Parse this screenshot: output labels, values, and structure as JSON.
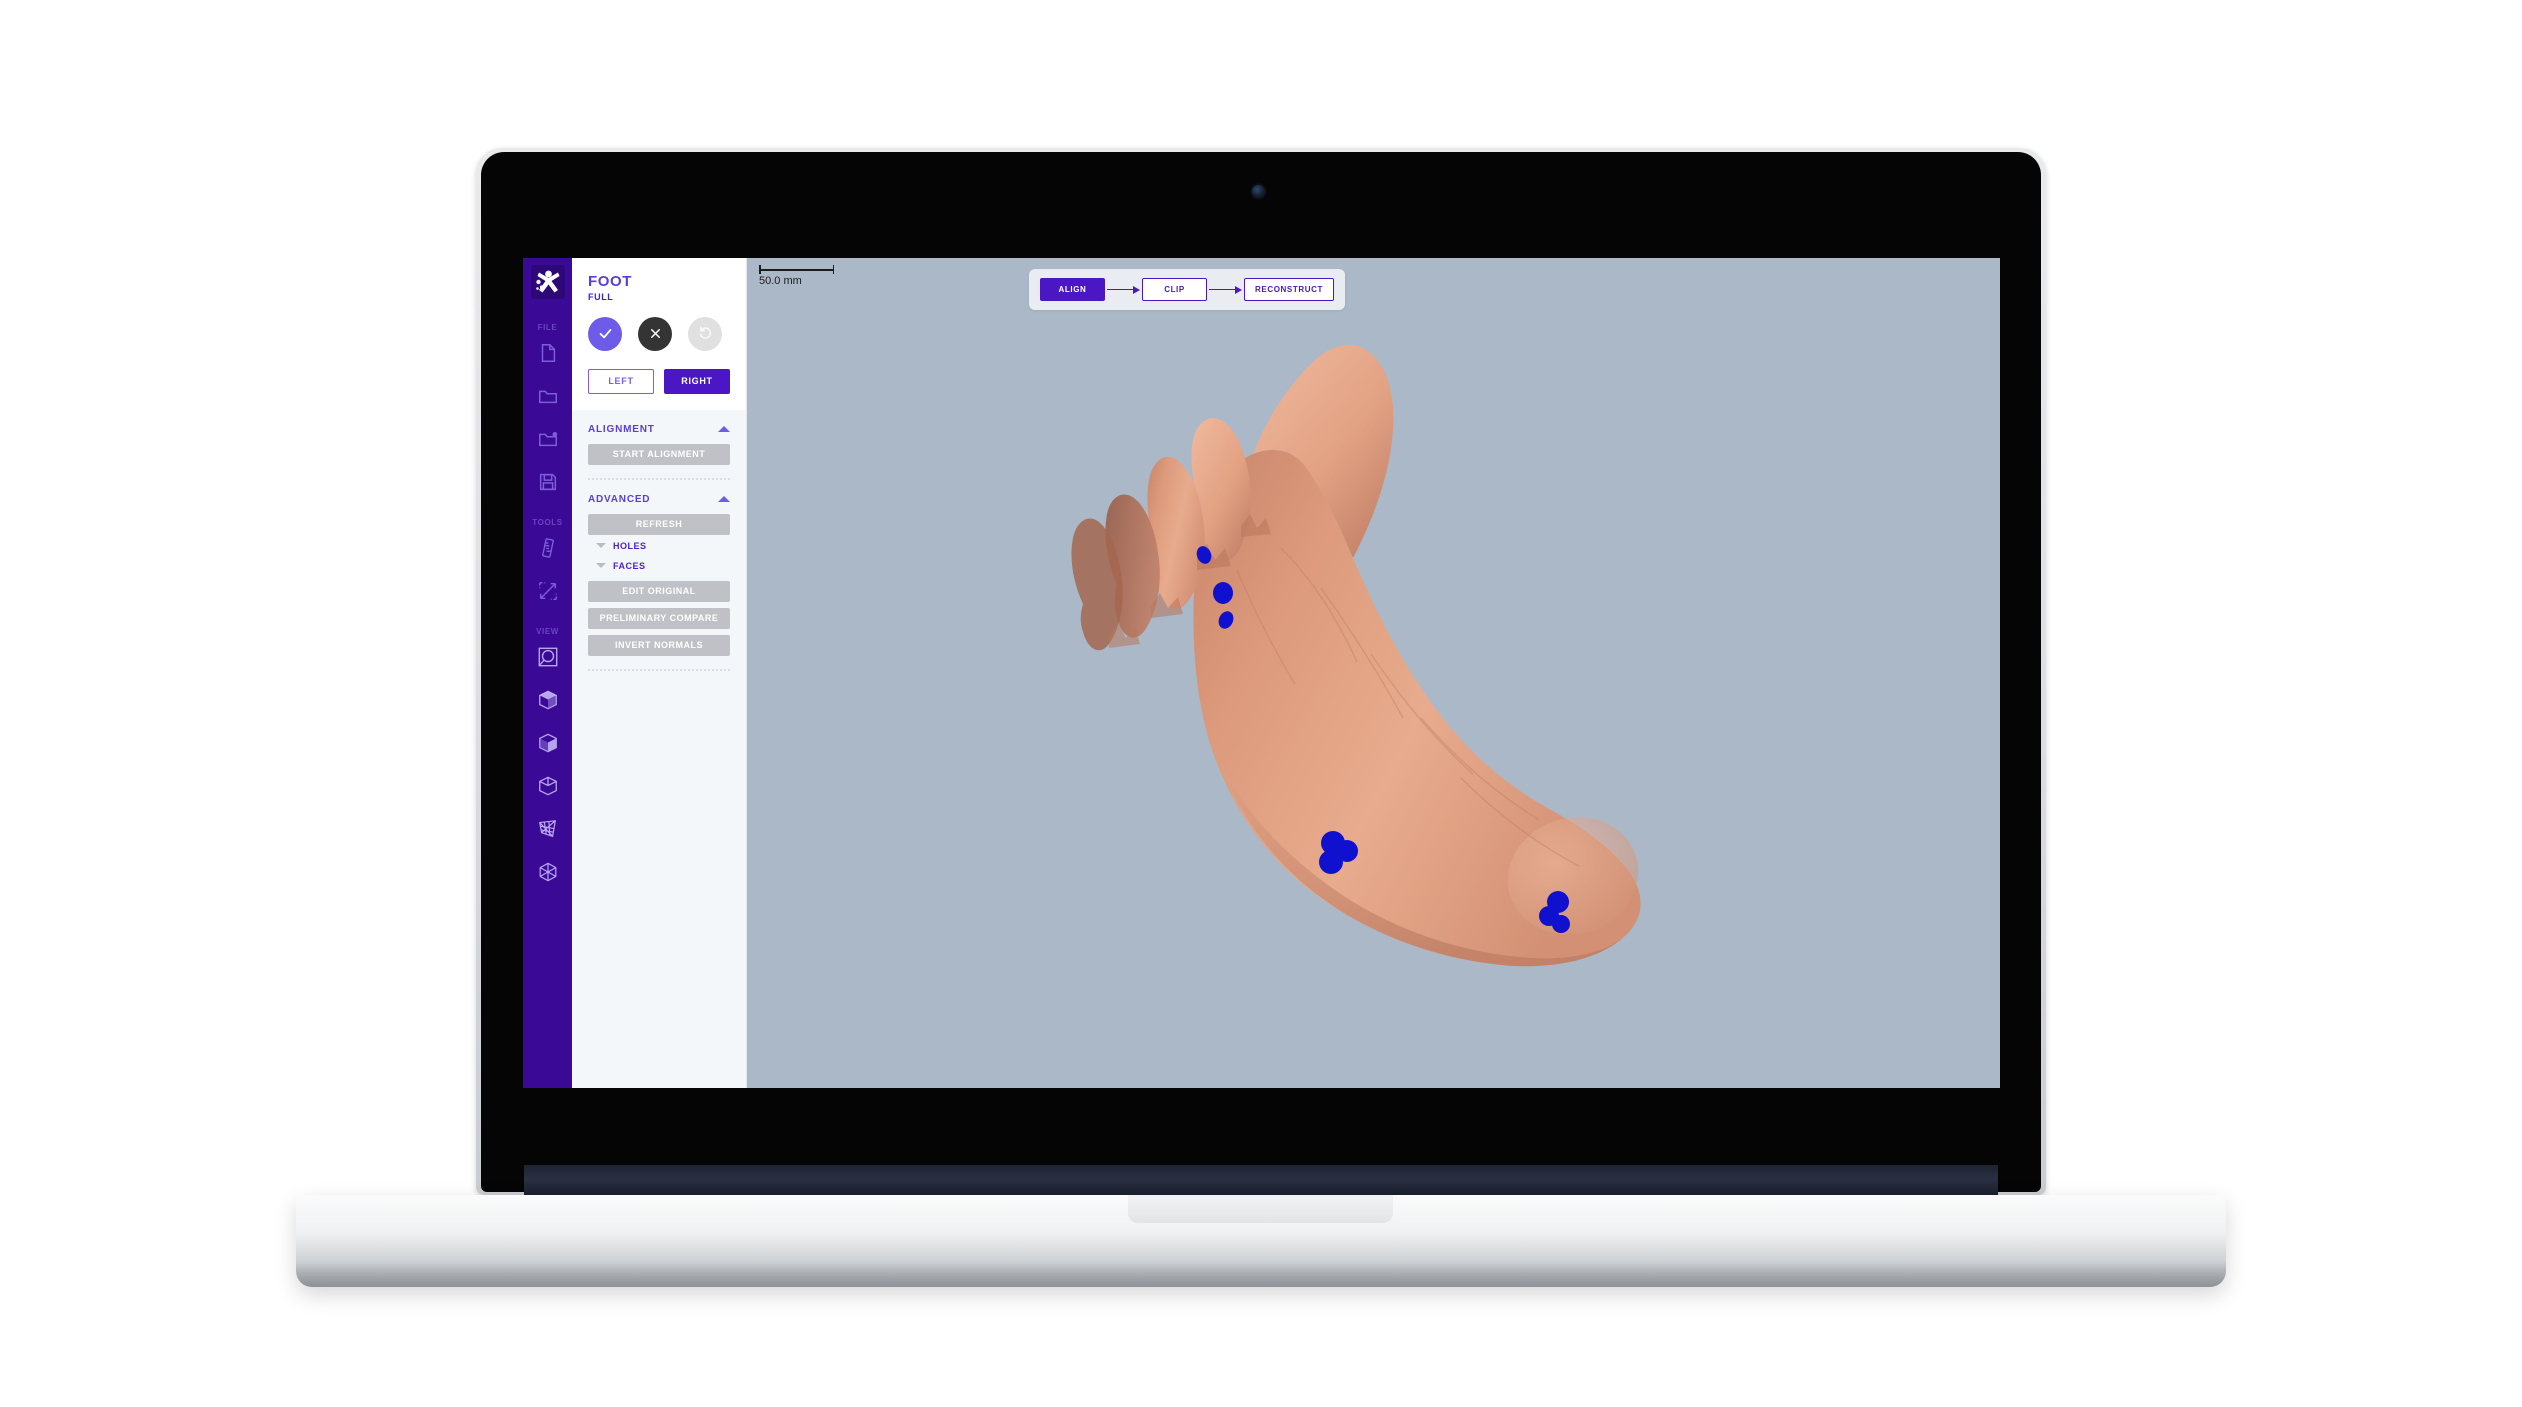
{
  "app": {
    "logo_icon": "human-figure-logo",
    "screen_bg": "#f4f7fa",
    "accent_purple": "#4b17c4",
    "accent_light_purple": "#6c5ce7",
    "rail_bg": "#3a0a96",
    "viewport_bg": "#aab8c8",
    "model_color": "#dd9a7c",
    "marker_color": "#1010cf"
  },
  "rail": {
    "groups": [
      {
        "label": "FILE",
        "items": [
          {
            "name": "new-file-icon",
            "title": "New"
          },
          {
            "name": "open-folder-icon",
            "title": "Open"
          },
          {
            "name": "open-folder-add-icon",
            "title": "Import"
          },
          {
            "name": "save-disk-icon",
            "title": "Save"
          }
        ]
      },
      {
        "label": "TOOLS",
        "items": [
          {
            "name": "ruler-icon",
            "title": "Measure"
          },
          {
            "name": "resize-icon",
            "title": "Scale"
          }
        ]
      },
      {
        "label": "VIEW",
        "items": [
          {
            "name": "viewport-circle-icon",
            "title": "Fit View"
          },
          {
            "name": "cube-shaded-icon",
            "title": "Shaded"
          },
          {
            "name": "cube-solid-icon",
            "title": "Solid"
          },
          {
            "name": "cube-outline-icon",
            "title": "Wireframe Box"
          },
          {
            "name": "mesh-grid-icon",
            "title": "Mesh"
          },
          {
            "name": "polygon-icon",
            "title": "Polygons"
          }
        ]
      }
    ]
  },
  "panel": {
    "title": "FOOT",
    "subtitle": "FULL",
    "actions": [
      {
        "name": "confirm-button",
        "icon": "check-icon",
        "state": "enabled"
      },
      {
        "name": "cancel-button",
        "icon": "close-icon",
        "state": "enabled"
      },
      {
        "name": "reset-button",
        "icon": "undo-icon",
        "state": "disabled"
      }
    ],
    "side_toggle": {
      "left_label": "LEFT",
      "right_label": "RIGHT",
      "selected": "RIGHT"
    },
    "sections": [
      {
        "title": "ALIGNMENT",
        "expanded": true,
        "buttons": [
          {
            "label": "START ALIGNMENT",
            "state": "disabled"
          }
        ]
      },
      {
        "title": "ADVANCED",
        "expanded": true,
        "buttons": [
          {
            "label": "REFRESH",
            "state": "disabled"
          }
        ],
        "subsections": [
          {
            "label": "HOLES",
            "expanded": false
          },
          {
            "label": "FACES",
            "expanded": false
          }
        ],
        "extra_buttons": [
          {
            "label": "EDIT ORIGINAL",
            "state": "disabled"
          },
          {
            "label": "PRELIMINARY COMPARE",
            "state": "disabled"
          },
          {
            "label": "INVERT NORMALS",
            "state": "disabled"
          }
        ]
      }
    ]
  },
  "viewport": {
    "scalebar": {
      "label": "50.0 mm",
      "length_mm": 50.0
    },
    "workflow": {
      "steps": [
        {
          "label": "ALIGN",
          "active": true
        },
        {
          "label": "CLIP",
          "active": false
        },
        {
          "label": "RECONSTRUCT",
          "active": false
        }
      ]
    },
    "model": {
      "name": "foot-scan-mesh",
      "description": "3D scanned right foot mesh, skin-tone shaded",
      "landmark_count": 7
    }
  }
}
